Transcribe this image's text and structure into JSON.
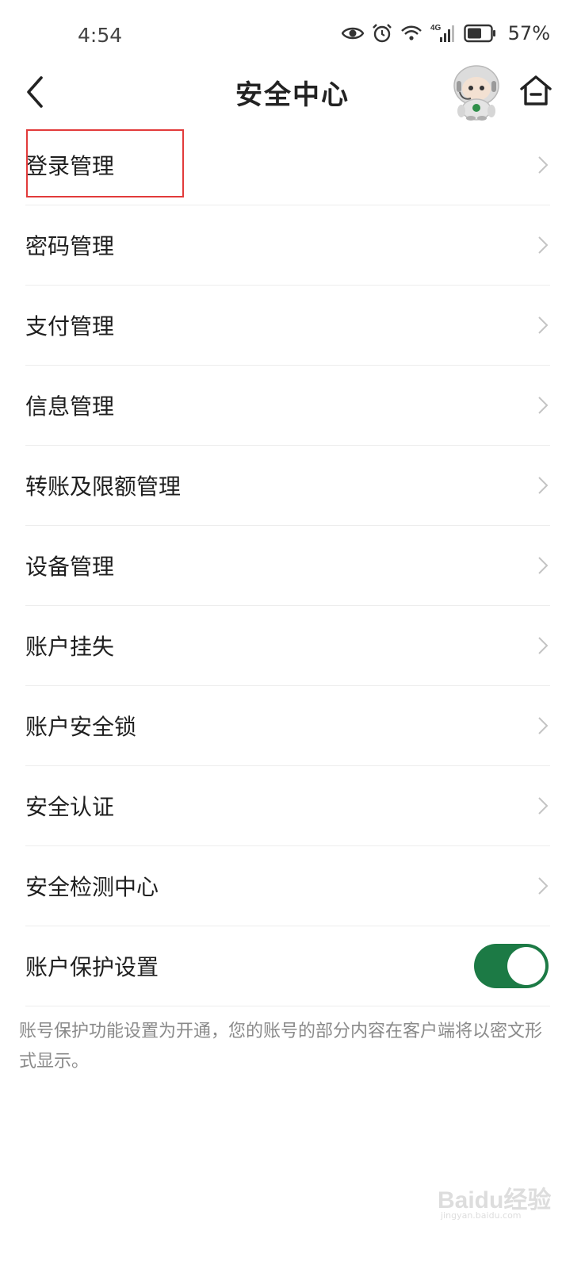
{
  "status_bar": {
    "time": "4:54",
    "network": "4G",
    "battery": "57%"
  },
  "header": {
    "title": "安全中心",
    "back_icon": "chevron-left-icon",
    "home_icon": "home-icon",
    "mascot": "robot-mascot"
  },
  "menu": [
    {
      "label": "登录管理",
      "control": "chevron"
    },
    {
      "label": "密码管理",
      "control": "chevron"
    },
    {
      "label": "支付管理",
      "control": "chevron"
    },
    {
      "label": "信息管理",
      "control": "chevron"
    },
    {
      "label": "转账及限额管理",
      "control": "chevron"
    },
    {
      "label": "设备管理",
      "control": "chevron"
    },
    {
      "label": "账户挂失",
      "control": "chevron"
    },
    {
      "label": "账户安全锁",
      "control": "chevron"
    },
    {
      "label": "安全认证",
      "control": "chevron"
    },
    {
      "label": "安全检测中心",
      "control": "chevron"
    },
    {
      "label": "账户保护设置",
      "control": "toggle",
      "toggle_on": true
    }
  ],
  "footnote": "账号保护功能设置为开通，您的账号的部分内容在客户端将以密文形式显示。",
  "watermark": {
    "main": "Baidu经验",
    "sub": "jingyan.baidu.com"
  },
  "colors": {
    "toggle_on": "#1c7a45",
    "highlight": "#e23b3b",
    "divider": "#ededed"
  }
}
